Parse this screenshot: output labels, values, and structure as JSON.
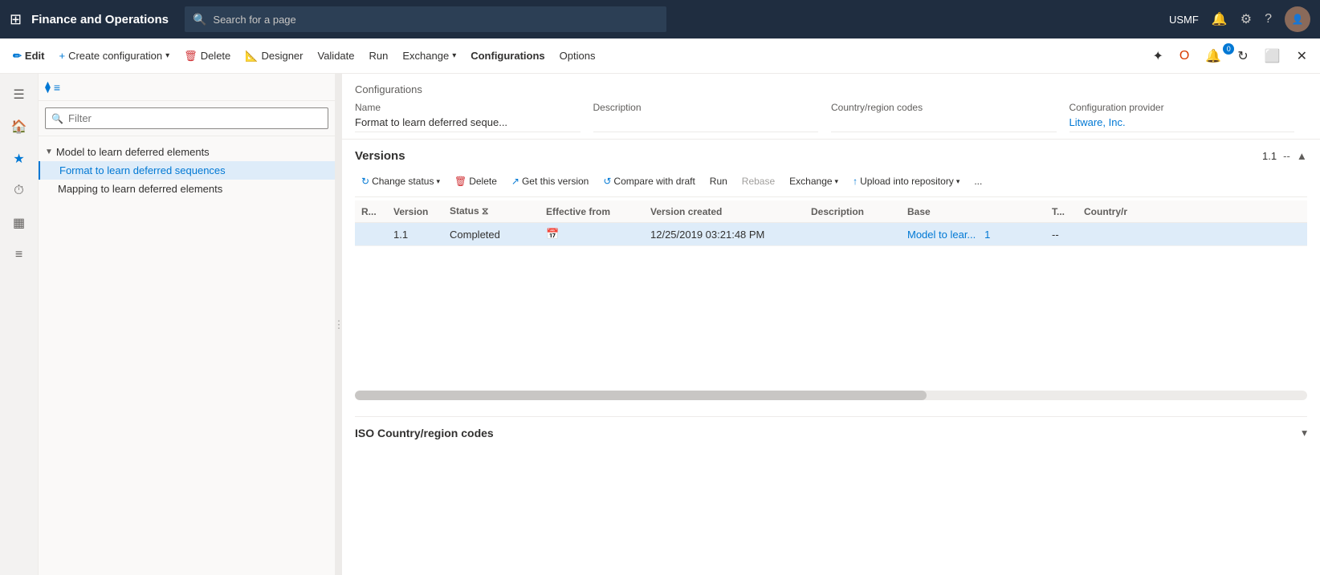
{
  "app": {
    "title": "Finance and Operations"
  },
  "topnav": {
    "search_placeholder": "Search for a page",
    "user": "USMF"
  },
  "actionbar": {
    "edit_label": "Edit",
    "create_label": "Create configuration",
    "delete_label": "Delete",
    "designer_label": "Designer",
    "validate_label": "Validate",
    "run_label": "Run",
    "exchange_label": "Exchange",
    "configurations_label": "Configurations",
    "options_label": "Options"
  },
  "sidebar": {
    "icons": [
      "⊞",
      "🏠",
      "★",
      "⏱",
      "▦",
      "≡"
    ]
  },
  "tree": {
    "filter_placeholder": "Filter",
    "parent_item": "Model to learn deferred elements",
    "child_item_1": "Format to learn deferred sequences",
    "child_item_2": "Mapping to learn deferred elements"
  },
  "config": {
    "section_title": "Configurations",
    "fields": {
      "name_label": "Name",
      "name_value": "Format to learn deferred seque...",
      "description_label": "Description",
      "description_value": "",
      "country_label": "Country/region codes",
      "country_value": "",
      "provider_label": "Configuration provider",
      "provider_value": "Litware, Inc."
    }
  },
  "versions": {
    "section_title": "Versions",
    "version_number": "1.1",
    "separator": "--",
    "toolbar": {
      "change_status_label": "Change status",
      "delete_label": "Delete",
      "get_version_label": "Get this version",
      "compare_label": "Compare with draft",
      "run_label": "Run",
      "rebase_label": "Rebase",
      "exchange_label": "Exchange",
      "upload_label": "Upload into repository",
      "more_label": "..."
    },
    "table": {
      "columns": [
        "R...",
        "Version",
        "Status",
        "Effective from",
        "Version created",
        "Description",
        "Base",
        "T...",
        "Country/r"
      ],
      "rows": [
        {
          "r": "",
          "version": "1.1",
          "status": "Completed",
          "effective_from": "",
          "version_created": "12/25/2019 03:21:48 PM",
          "description": "",
          "base": "Model to lear...",
          "base_link": "1",
          "t": "--",
          "country": ""
        }
      ]
    }
  },
  "iso_section": {
    "title": "ISO Country/region codes"
  }
}
